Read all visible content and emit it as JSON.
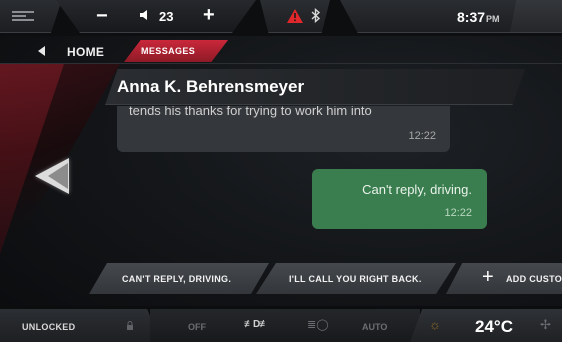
{
  "status_bar": {
    "volume_minus": "−",
    "volume_value": "23",
    "volume_plus": "+",
    "time": "8:37",
    "ampm": "PM",
    "icons": [
      "menu-icon",
      "speaker-icon",
      "warning-icon",
      "bluetooth-icon"
    ],
    "alert_color": "#e0272b"
  },
  "nav": {
    "home_label": "HOME",
    "active_tab_label": "MESSAGES",
    "active_tab_color": "#b0202f"
  },
  "conversation": {
    "contact_name": "Anna K. Behrensmeyer",
    "incoming": {
      "text": "tends his thanks for trying to work him into",
      "time": "12:22"
    },
    "outgoing": {
      "text": "Can't reply, driving.",
      "time": "12:22",
      "color": "#3a7d4e"
    }
  },
  "quick_replies": [
    "CAN'T REPLY, DRIVING.",
    "I'LL CALL YOU RIGHT BACK.",
    "ADD CUSTO"
  ],
  "bottom_bar": {
    "lock_status": "UNLOCKED",
    "lights_off": "OFF",
    "lights_auto": "AUTO",
    "temperature": "24°C",
    "icons": [
      "lock-icon",
      "fog-light-icon",
      "low-beam-icon",
      "sun-icon",
      "fan-icon"
    ]
  }
}
